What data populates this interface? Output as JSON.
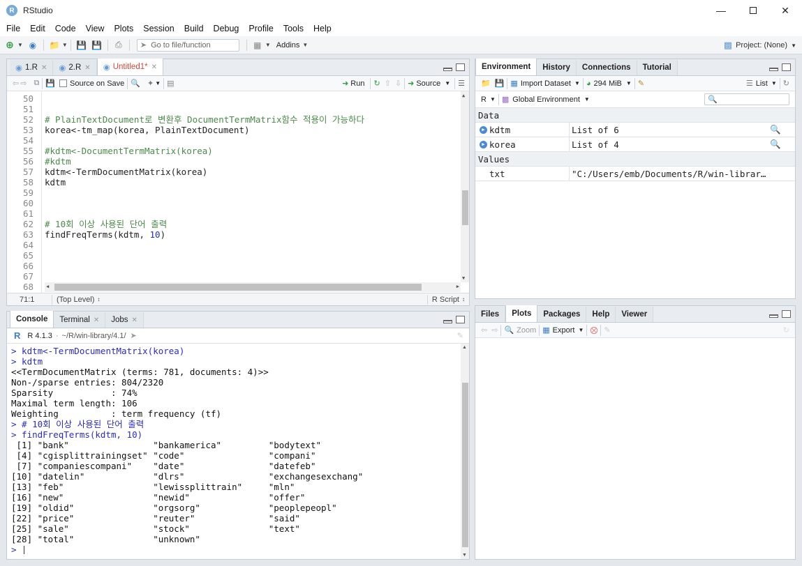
{
  "window": {
    "title": "RStudio",
    "logo_letter": "R"
  },
  "menu": [
    "File",
    "Edit",
    "Code",
    "View",
    "Plots",
    "Session",
    "Build",
    "Debug",
    "Profile",
    "Tools",
    "Help"
  ],
  "toolbar": {
    "goto_placeholder": "Go to file/function",
    "addins": "Addins",
    "project": "Project: (None)"
  },
  "editor": {
    "tabs": [
      {
        "label": "1.R",
        "active": false
      },
      {
        "label": "2.R",
        "active": false
      },
      {
        "label": "Untitled1*",
        "active": true
      }
    ],
    "source_on_save": "Source on Save",
    "run": "Run",
    "source": "Source",
    "lines": [
      {
        "n": "50",
        "code": ""
      },
      {
        "n": "51",
        "code": ""
      },
      {
        "n": "52",
        "code": "# PlainTextDocument로 변환후 DocumentTermMatrix함수 적용이 가능하다",
        "comment": true
      },
      {
        "n": "53",
        "code": "korea<-tm_map(korea, PlainTextDocument)"
      },
      {
        "n": "54",
        "code": ""
      },
      {
        "n": "55",
        "code": "#kdtm<-DocumentTermMatrix(korea)",
        "comment": true
      },
      {
        "n": "56",
        "code": "#kdtm",
        "comment": true
      },
      {
        "n": "57",
        "code": "kdtm<-TermDocumentMatrix(korea)"
      },
      {
        "n": "58",
        "code": "kdtm"
      },
      {
        "n": "59",
        "code": ""
      },
      {
        "n": "60",
        "code": ""
      },
      {
        "n": "61",
        "code": ""
      },
      {
        "n": "62",
        "code": "# 10회 이상 사용된 단어 출력",
        "comment": true
      },
      {
        "n": "63",
        "code_pre": "findFreqTerms(kdtm, ",
        "code_num": "10",
        "code_post": ")"
      },
      {
        "n": "64",
        "code": ""
      },
      {
        "n": "65",
        "code": ""
      },
      {
        "n": "66",
        "code": ""
      },
      {
        "n": "67",
        "code": ""
      },
      {
        "n": "68",
        "code": ""
      }
    ],
    "status_pos": "71:1",
    "status_scope": "(Top Level)",
    "status_type": "R Script"
  },
  "console": {
    "tabs": [
      {
        "label": "Console",
        "active": true
      },
      {
        "label": "Terminal",
        "active": false
      },
      {
        "label": "Jobs",
        "active": false
      }
    ],
    "r_version": "R 4.1.3",
    "path": "~/R/win-library/4.1/",
    "lines": [
      {
        "text": "> kdtm<-TermDocumentMatrix(korea)",
        "input": true
      },
      {
        "text": "> kdtm",
        "input": true
      },
      {
        "text": "<<TermDocumentMatrix (terms: 781, documents: 4)>>"
      },
      {
        "text": "Non-/sparse entries: 804/2320"
      },
      {
        "text": "Sparsity           : 74%"
      },
      {
        "text": "Maximal term length: 106"
      },
      {
        "text": "Weighting          : term frequency (tf)"
      },
      {
        "text": "> # 10회 이상 사용된 단어 출력",
        "input": true
      },
      {
        "text": "> findFreqTerms(kdtm, 10)",
        "input": true
      },
      {
        "text": " [1] \"bank\"                \"bankamerica\"         \"bodytext\""
      },
      {
        "text": " [4] \"cgisplittrainingset\" \"code\"                \"compani\""
      },
      {
        "text": " [7] \"companiescompani\"    \"date\"                \"datefeb\""
      },
      {
        "text": "[10] \"datelin\"             \"dlrs\"                \"exchangesexchang\""
      },
      {
        "text": "[13] \"feb\"                 \"lewissplittrain\"     \"mln\""
      },
      {
        "text": "[16] \"new\"                 \"newid\"               \"offer\""
      },
      {
        "text": "[19] \"oldid\"               \"orgsorg\"             \"peoplepeopl\""
      },
      {
        "text": "[22] \"price\"               \"reuter\"              \"said\""
      },
      {
        "text": "[25] \"sale\"                \"stock\"               \"text\""
      },
      {
        "text": "[28] \"total\"               \"unknown\""
      },
      {
        "text": "> ",
        "input": true
      }
    ]
  },
  "environment": {
    "tabs": [
      {
        "label": "Environment",
        "active": true
      },
      {
        "label": "History",
        "active": false
      },
      {
        "label": "Connections",
        "active": false
      },
      {
        "label": "Tutorial",
        "active": false
      }
    ],
    "import_dataset": "Import Dataset",
    "memory": "294 MiB",
    "view_mode": "List",
    "lang": "R",
    "scope": "Global Environment",
    "section_data": "Data",
    "section_values": "Values",
    "data_rows": [
      {
        "name": "kdtm",
        "value": "List of  6"
      },
      {
        "name": "korea",
        "value": "List of  4"
      }
    ],
    "value_rows": [
      {
        "name": "txt",
        "value": "\"C:/Users/emb/Documents/R/win-librar…"
      }
    ]
  },
  "files": {
    "tabs": [
      {
        "label": "Files",
        "active": false
      },
      {
        "label": "Plots",
        "active": true
      },
      {
        "label": "Packages",
        "active": false
      },
      {
        "label": "Help",
        "active": false
      },
      {
        "label": "Viewer",
        "active": false
      }
    ],
    "zoom": "Zoom",
    "export": "Export"
  }
}
